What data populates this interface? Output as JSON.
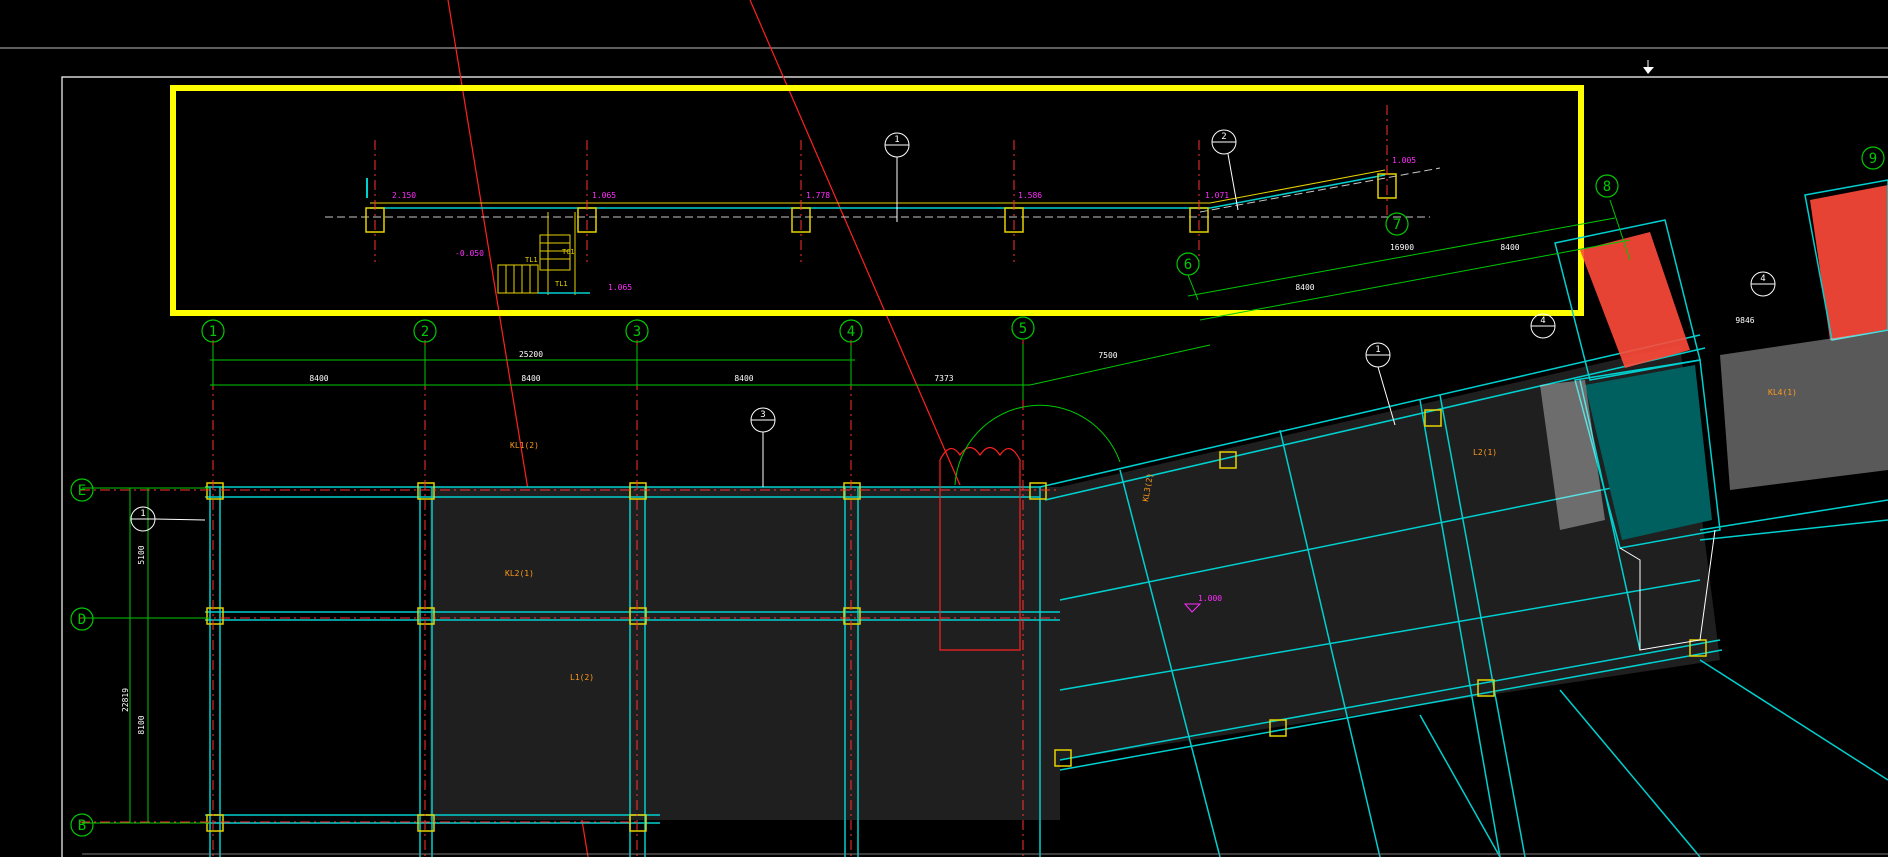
{
  "app": {
    "name": "CAD drawing viewer"
  },
  "colors": {
    "background": "#000000",
    "grid_axis": "#00c800",
    "beam_cyan": "#00d0d0",
    "column_yellow": "#e6d200",
    "annotation_orange": "#ff9a1a",
    "level_magenta": "#ff2cff",
    "highlight_box": "#ffff00",
    "section_red": "#ff2020",
    "white": "#ffffff"
  },
  "axes_numeric": [
    "1",
    "2",
    "3",
    "4",
    "5",
    "6",
    "7",
    "8",
    "9"
  ],
  "axes_letter": [
    "E",
    "D",
    "B"
  ],
  "dimensions": {
    "overall": "25200",
    "bays": [
      "8400",
      "8400",
      "8400",
      "7373"
    ],
    "left_overall": "22819",
    "left_bays": [
      "5100",
      "8100"
    ],
    "angled_bays": [
      "7500",
      "8400",
      "16900",
      "8400",
      "9846"
    ]
  },
  "elevation_view": {
    "level_marks": [
      "2.150",
      "1.065",
      "1.778",
      "1.586",
      "1.071",
      "1.005",
      "-0.050",
      "1.065"
    ],
    "section_marks": [
      "1",
      "2"
    ],
    "stair_labels": [
      "TC1",
      "TL1",
      "TL1"
    ]
  },
  "plan_labels": {
    "section_marks": [
      "1",
      "1",
      "3",
      "4",
      "4"
    ],
    "beams": [
      "KL1(2)",
      "KL2(1)",
      "L1(2)",
      "KL3(2)",
      "L2(1)",
      "KL4(1)"
    ],
    "level": "1.000"
  }
}
